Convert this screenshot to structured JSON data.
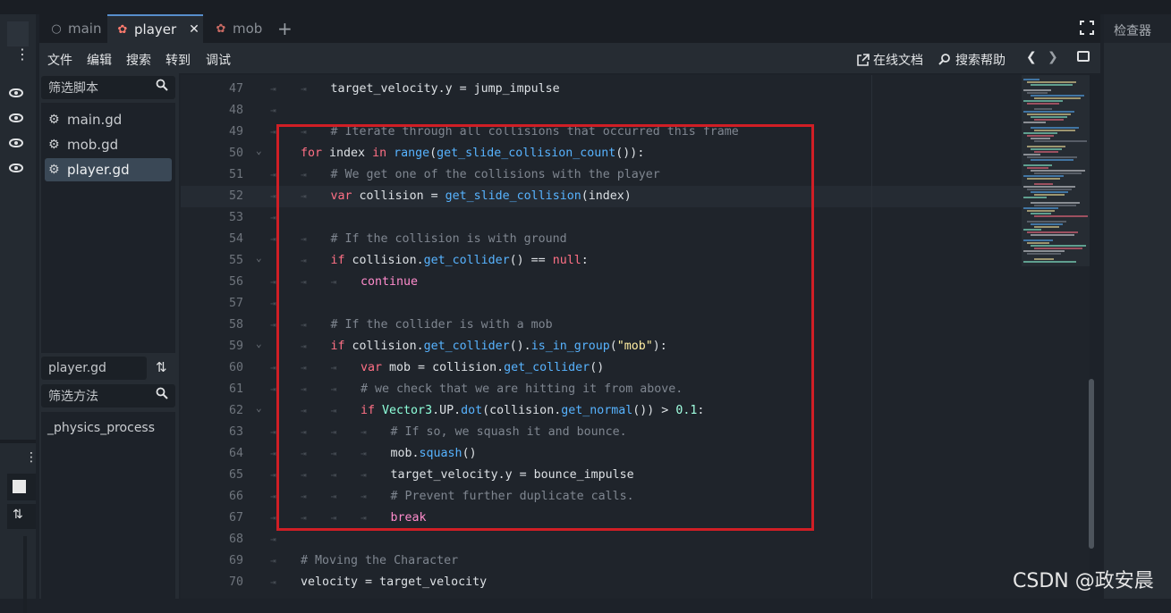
{
  "tabs": [
    {
      "label": "main",
      "icon": "circle-icon",
      "active": false
    },
    {
      "label": "player",
      "icon": "godot-icon",
      "active": true,
      "close": "✕"
    },
    {
      "label": "mob",
      "icon": "godot-icon",
      "active": false
    }
  ],
  "add_tab": "+",
  "inspector_title": "检查器",
  "menu": [
    "文件",
    "编辑",
    "搜索",
    "转到",
    "调试"
  ],
  "menu_right": {
    "online_docs": "在线文档",
    "search_help": "搜索帮助",
    "prev": "❮",
    "next": "❯"
  },
  "script_filter_placeholder": "筛选脚本",
  "scripts": [
    {
      "name": "main.gd",
      "selected": false
    },
    {
      "name": "mob.gd",
      "selected": false
    },
    {
      "name": "player.gd",
      "selected": true
    }
  ],
  "current_script": "player.gd",
  "method_filter_placeholder": "筛选方法",
  "methods": [
    "_physics_process"
  ],
  "colors": {
    "accent": "#578ecc",
    "highlight_box": "#d01e25",
    "keyword": "#ff7085",
    "function": "#57b3ff",
    "comment": "#7f8690"
  },
  "code_lines": [
    {
      "n": "47",
      "indent": 2,
      "fold": false,
      "segs": [
        [
          "id",
          "target_velocity.y = jump_impulse"
        ]
      ]
    },
    {
      "n": "48",
      "indent": 1,
      "fold": false,
      "segs": []
    },
    {
      "n": "49",
      "indent": 2,
      "fold": false,
      "segs": [
        [
          "cm",
          "# Iterate through all collisions that occurred this frame"
        ]
      ]
    },
    {
      "n": "50",
      "indent": 0,
      "fold": true,
      "segs": [
        [
          "kw",
          "for"
        ],
        [
          "id",
          " index "
        ],
        [
          "kw",
          "in"
        ],
        [
          "id",
          " "
        ],
        [
          "fn",
          "range"
        ],
        [
          "id",
          "("
        ],
        [
          "fn",
          "get_slide_collision_count"
        ],
        [
          "id",
          "()):"
        ]
      ]
    },
    {
      "n": "51",
      "indent": 2,
      "fold": false,
      "segs": [
        [
          "cm",
          "# We get one of the collisions with the player"
        ]
      ]
    },
    {
      "n": "52",
      "indent": 2,
      "fold": false,
      "current": true,
      "segs": [
        [
          "kw",
          "var"
        ],
        [
          "id",
          " collision = "
        ],
        [
          "fn",
          "get_slide_collision"
        ],
        [
          "id",
          "(index)"
        ]
      ]
    },
    {
      "n": "53",
      "indent": 0,
      "fold": false,
      "segs": []
    },
    {
      "n": "54",
      "indent": 2,
      "fold": false,
      "segs": [
        [
          "cm",
          "# If the collision is with ground"
        ]
      ]
    },
    {
      "n": "55",
      "indent": 2,
      "fold": true,
      "segs": [
        [
          "kw",
          "if"
        ],
        [
          "id",
          " collision."
        ],
        [
          "fn",
          "get_collider"
        ],
        [
          "id",
          "() == "
        ],
        [
          "kw",
          "null"
        ],
        [
          "id",
          ":"
        ]
      ]
    },
    {
      "n": "56",
      "indent": 3,
      "fold": false,
      "segs": [
        [
          "ctl",
          "continue"
        ]
      ]
    },
    {
      "n": "57",
      "indent": 0,
      "fold": false,
      "segs": []
    },
    {
      "n": "58",
      "indent": 2,
      "fold": false,
      "segs": [
        [
          "cm",
          "# If the collider is with a mob"
        ]
      ]
    },
    {
      "n": "59",
      "indent": 2,
      "fold": true,
      "segs": [
        [
          "kw",
          "if"
        ],
        [
          "id",
          " collision."
        ],
        [
          "fn",
          "get_collider"
        ],
        [
          "id",
          "()."
        ],
        [
          "fn",
          "is_in_group"
        ],
        [
          "id",
          "("
        ],
        [
          "str",
          "\"mob\""
        ],
        [
          "id",
          "):"
        ]
      ]
    },
    {
      "n": "60",
      "indent": 3,
      "fold": false,
      "segs": [
        [
          "kw",
          "var"
        ],
        [
          "id",
          " mob = collision."
        ],
        [
          "fn",
          "get_collider"
        ],
        [
          "id",
          "()"
        ]
      ]
    },
    {
      "n": "61",
      "indent": 3,
      "fold": false,
      "segs": [
        [
          "cm",
          "# we check that we are hitting it from above."
        ]
      ]
    },
    {
      "n": "62",
      "indent": 3,
      "fold": true,
      "segs": [
        [
          "kw",
          "if"
        ],
        [
          "id",
          " "
        ],
        [
          "cls",
          "Vector3"
        ],
        [
          "id",
          ".UP."
        ],
        [
          "fn",
          "dot"
        ],
        [
          "id",
          "(collision."
        ],
        [
          "fn",
          "get_normal"
        ],
        [
          "id",
          "()) > "
        ],
        [
          "num",
          "0.1"
        ],
        [
          "id",
          ":"
        ]
      ]
    },
    {
      "n": "63",
      "indent": 4,
      "fold": false,
      "segs": [
        [
          "cm",
          "# If so, we squash it and bounce."
        ]
      ]
    },
    {
      "n": "64",
      "indent": 4,
      "fold": false,
      "segs": [
        [
          "id",
          "mob."
        ],
        [
          "fn",
          "squash"
        ],
        [
          "id",
          "()"
        ]
      ]
    },
    {
      "n": "65",
      "indent": 4,
      "fold": false,
      "segs": [
        [
          "id",
          "target_velocity.y = bounce_impulse"
        ]
      ]
    },
    {
      "n": "66",
      "indent": 4,
      "fold": false,
      "segs": [
        [
          "cm",
          "# Prevent further duplicate calls."
        ]
      ]
    },
    {
      "n": "67",
      "indent": 4,
      "fold": false,
      "segs": [
        [
          "ctl",
          "break"
        ]
      ]
    },
    {
      "n": "68",
      "indent": 0,
      "fold": false,
      "segs": []
    },
    {
      "n": "69",
      "indent": 0,
      "fold": false,
      "segs": [
        [
          "cm",
          "# Moving the Character"
        ]
      ]
    },
    {
      "n": "70",
      "indent": 0,
      "fold": false,
      "segs": [
        [
          "id",
          "velocity = target_velocity"
        ]
      ]
    }
  ],
  "watermark": "CSDN @政安晨"
}
